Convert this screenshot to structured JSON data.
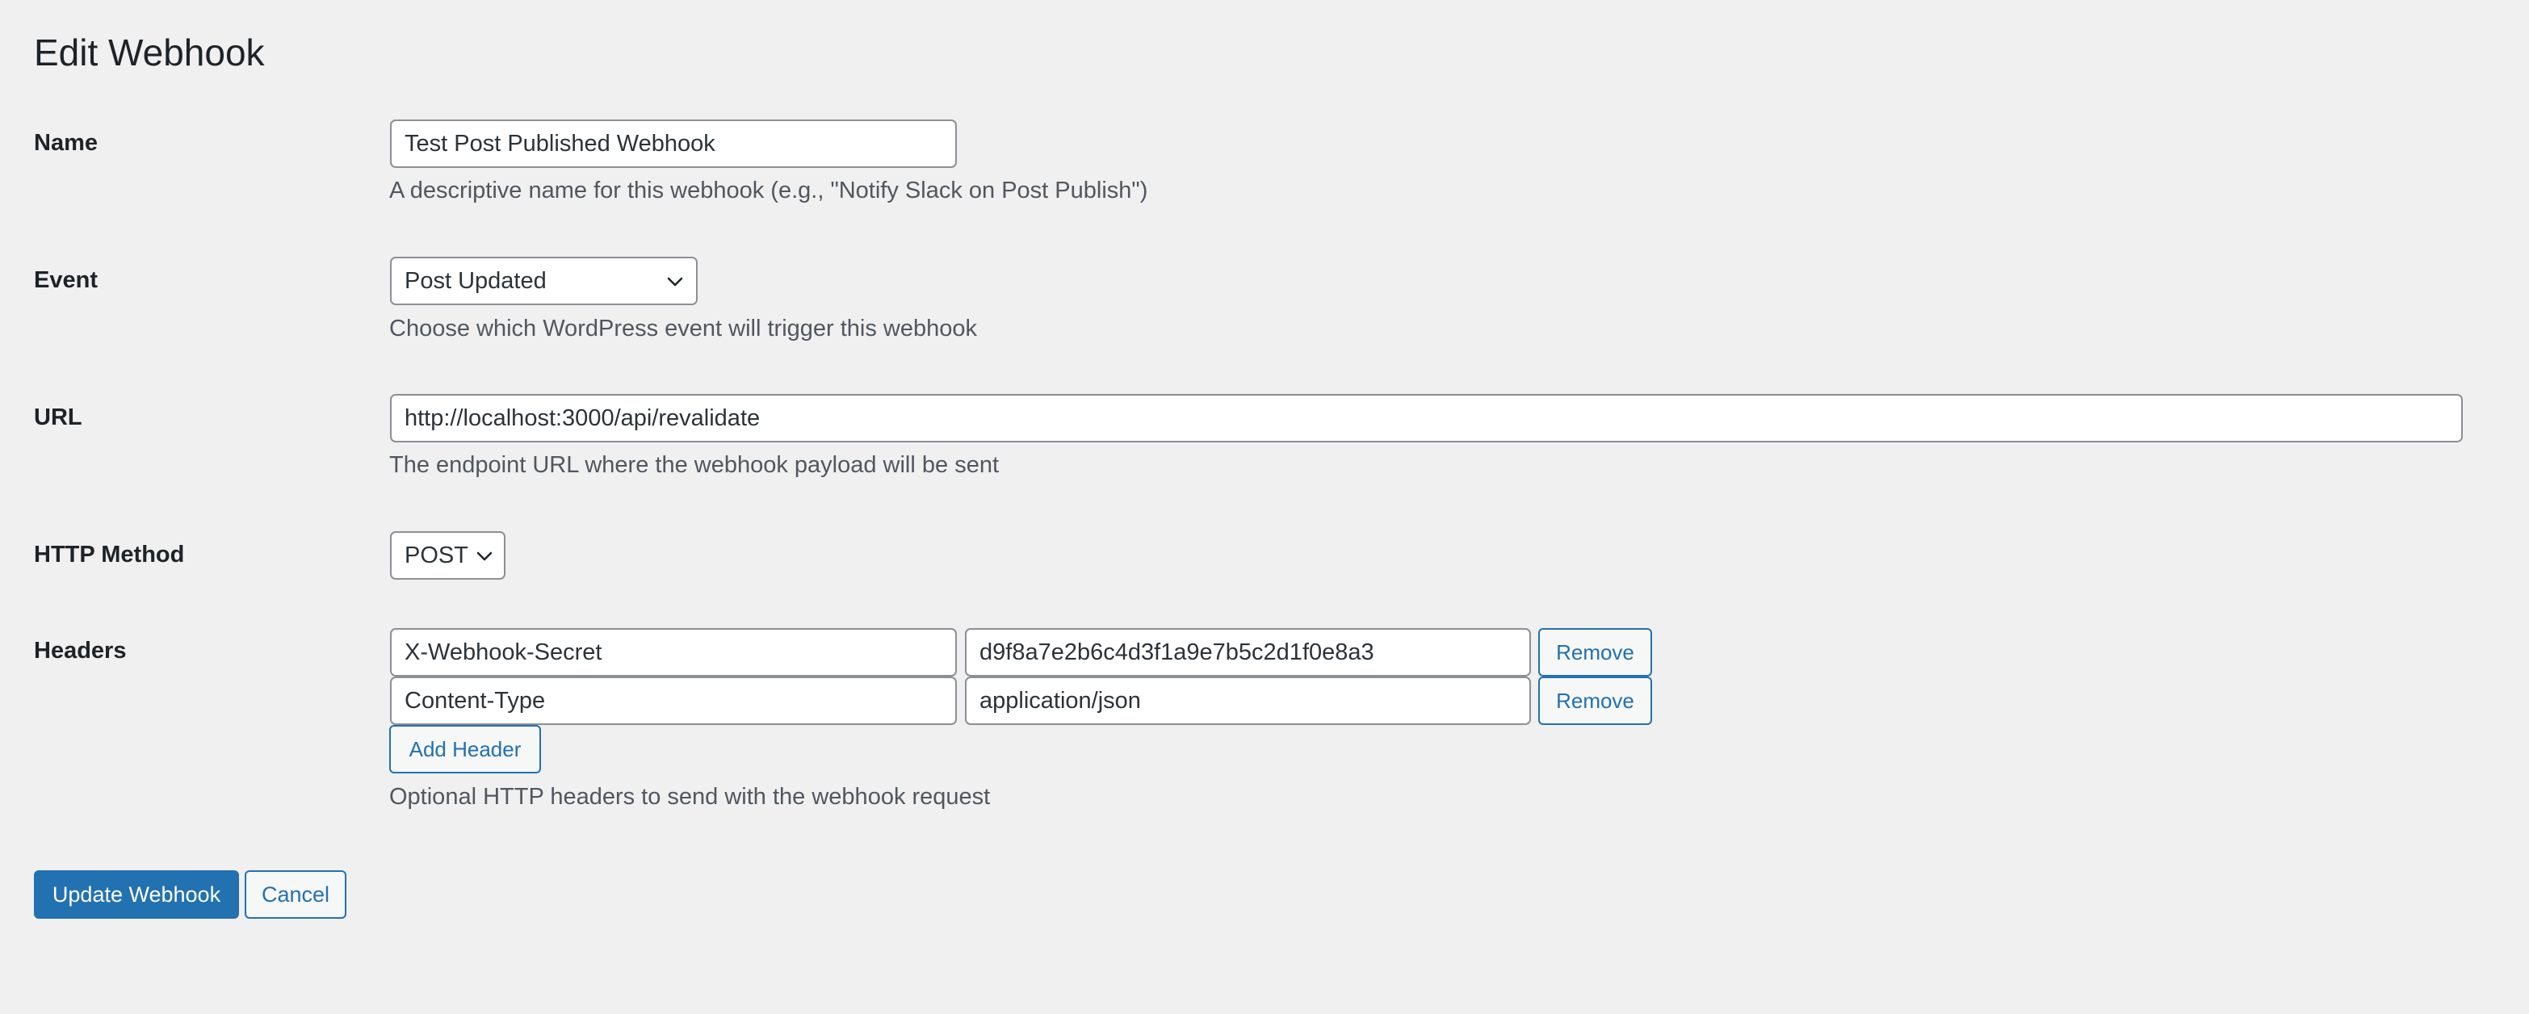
{
  "page": {
    "title": "Edit Webhook"
  },
  "form": {
    "name": {
      "label": "Name",
      "value": "Test Post Published Webhook",
      "description": "A descriptive name for this webhook (e.g., \"Notify Slack on Post Publish\")"
    },
    "event": {
      "label": "Event",
      "selected": "Post Updated",
      "description": "Choose which WordPress event will trigger this webhook"
    },
    "url": {
      "label": "URL",
      "value": "http://localhost:3000/api/revalidate",
      "description": "The endpoint URL where the webhook payload will be sent"
    },
    "method": {
      "label": "HTTP Method",
      "selected": "POST"
    },
    "headers": {
      "label": "Headers",
      "rows": [
        {
          "key": "X-Webhook-Secret",
          "value": "d9f8a7e2b6c4d3f1a9e7b5c2d1f0e8a3",
          "remove_label": "Remove"
        },
        {
          "key": "Content-Type",
          "value": "application/json",
          "remove_label": "Remove"
        }
      ],
      "add_label": "Add Header",
      "description": "Optional HTTP headers to send with the webhook request"
    }
  },
  "actions": {
    "submit_label": "Update Webhook",
    "cancel_label": "Cancel"
  },
  "icons": {
    "select_arrow": "chevron-down-icon"
  },
  "colors": {
    "accent": "#2271b1",
    "background": "#f0f0f1",
    "text": "#1d2327",
    "muted_text": "#50575e",
    "input_border": "#8c8f94"
  }
}
